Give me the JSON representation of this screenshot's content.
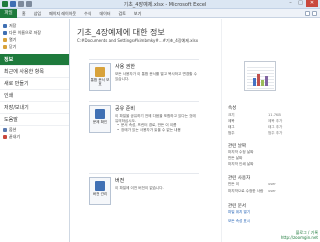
{
  "window": {
    "title": "기초_4장예제.xlsx - Microsoft Excel",
    "min": "–",
    "max": "□",
    "close": "✕"
  },
  "ribbon": {
    "file_tab": "파일",
    "tabs": [
      "홈",
      "삽입",
      "페이지 레이아웃",
      "수식",
      "데이터",
      "검토",
      "보기"
    ]
  },
  "sidebar": {
    "top_items": [
      {
        "label": "저장",
        "color": "#3f6fb3"
      },
      {
        "label": "다른 이름으로 저장",
        "color": "#3f6fb3"
      },
      {
        "label": "열기",
        "color": "#d8a23a"
      },
      {
        "label": "닫기",
        "color": "#d8a23a"
      }
    ],
    "active": "정보",
    "sections": [
      "최근에 사용한 항목",
      "새로 만들기",
      "인쇄",
      "저장/보내기",
      "도움말"
    ],
    "bottom_items": [
      {
        "label": "옵션",
        "color": "#5a7ab0"
      },
      {
        "label": "끝내기",
        "color": "#c9483c"
      }
    ]
  },
  "main": {
    "title": "기초_4장예제에 대한 정보",
    "path": "C:#Documents and Settings#kimbmky#...#기초_4장예제.xlsx",
    "cards": [
      {
        "button": "통합 문서 보호",
        "button_icon_color": "#d8a23a",
        "heading": "사용 권한",
        "text": "모든 사용자가 이 통합 문서를 열고 복사하고 변경할 수 있습니다."
      },
      {
        "button": "문제 확인",
        "button_icon_color": "#3f6fb3",
        "heading": "공유 준비",
        "text": "이 파일을 공유하기 전에 다음을 포함하고 있다는 것에 유의하십시오.",
        "bullets": [
          "문서 속성, 프린터 경로, 만든 이 이름",
          "장애가 있는 사용자가 읽을 수 없는 내용"
        ]
      },
      {
        "button": "버전 관리",
        "button_icon_color": "#3f6fb3",
        "heading": "버전",
        "text": "이 파일에 이전 버전이 없습니다."
      }
    ]
  },
  "properties": {
    "heading": "속성",
    "rows": [
      {
        "k": "크기",
        "v": "11.7KB"
      },
      {
        "k": "제목",
        "v": "제목 추가"
      },
      {
        "k": "태그",
        "v": "태그 추가"
      },
      {
        "k": "범주",
        "v": "범주 추가"
      }
    ],
    "dates_heading": "관련 날짜",
    "dates": [
      {
        "k": "마지막 수정 날짜",
        "v": ""
      },
      {
        "k": "만든 날짜",
        "v": ""
      },
      {
        "k": "마지막 인쇄 날짜",
        "v": ""
      }
    ],
    "people_heading": "관련 사용자",
    "people": [
      {
        "k": "만든 이",
        "v": "user"
      },
      {
        "k": "마지막으로 수정한 사람",
        "v": "user"
      }
    ],
    "docs_heading": "관련 문서",
    "links": [
      "파일 위치 열기",
      "모든 속성 표시"
    ]
  },
  "watermark": {
    "line1": "블로그 / 기록",
    "line2": "http://zoomgin.net"
  }
}
